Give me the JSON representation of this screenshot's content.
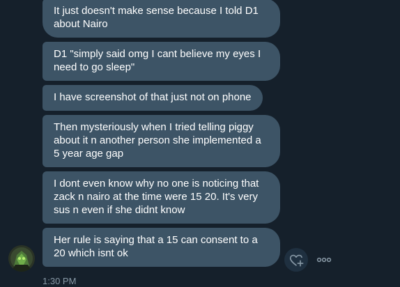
{
  "messages": [
    {
      "text": "It just doesn't make sense because I told D1 about Nairo"
    },
    {
      "text": "D1 \"simply said omg I cant believe my eyes I need to go sleep\""
    },
    {
      "text": "I have screenshot of that just not on phone"
    },
    {
      "text": "Then mysteriously when I tried telling piggy about it n another person she implemented a 5 year age gap"
    },
    {
      "text": "I dont even know why no one is noticing that zack n nairo at the time were 15 20. It's very sus n even if she didnt know"
    },
    {
      "text": "Her rule is saying that a 15 can consent to a 20 which isnt ok"
    }
  ],
  "timestamp": "1:30 PM",
  "icons": {
    "react": "heart-plus-icon",
    "more": "more-dots-icon",
    "avatar": "user-avatar"
  },
  "colors": {
    "background": "#15202b",
    "bubble": "#3d5466",
    "icon": "#8899a6"
  }
}
